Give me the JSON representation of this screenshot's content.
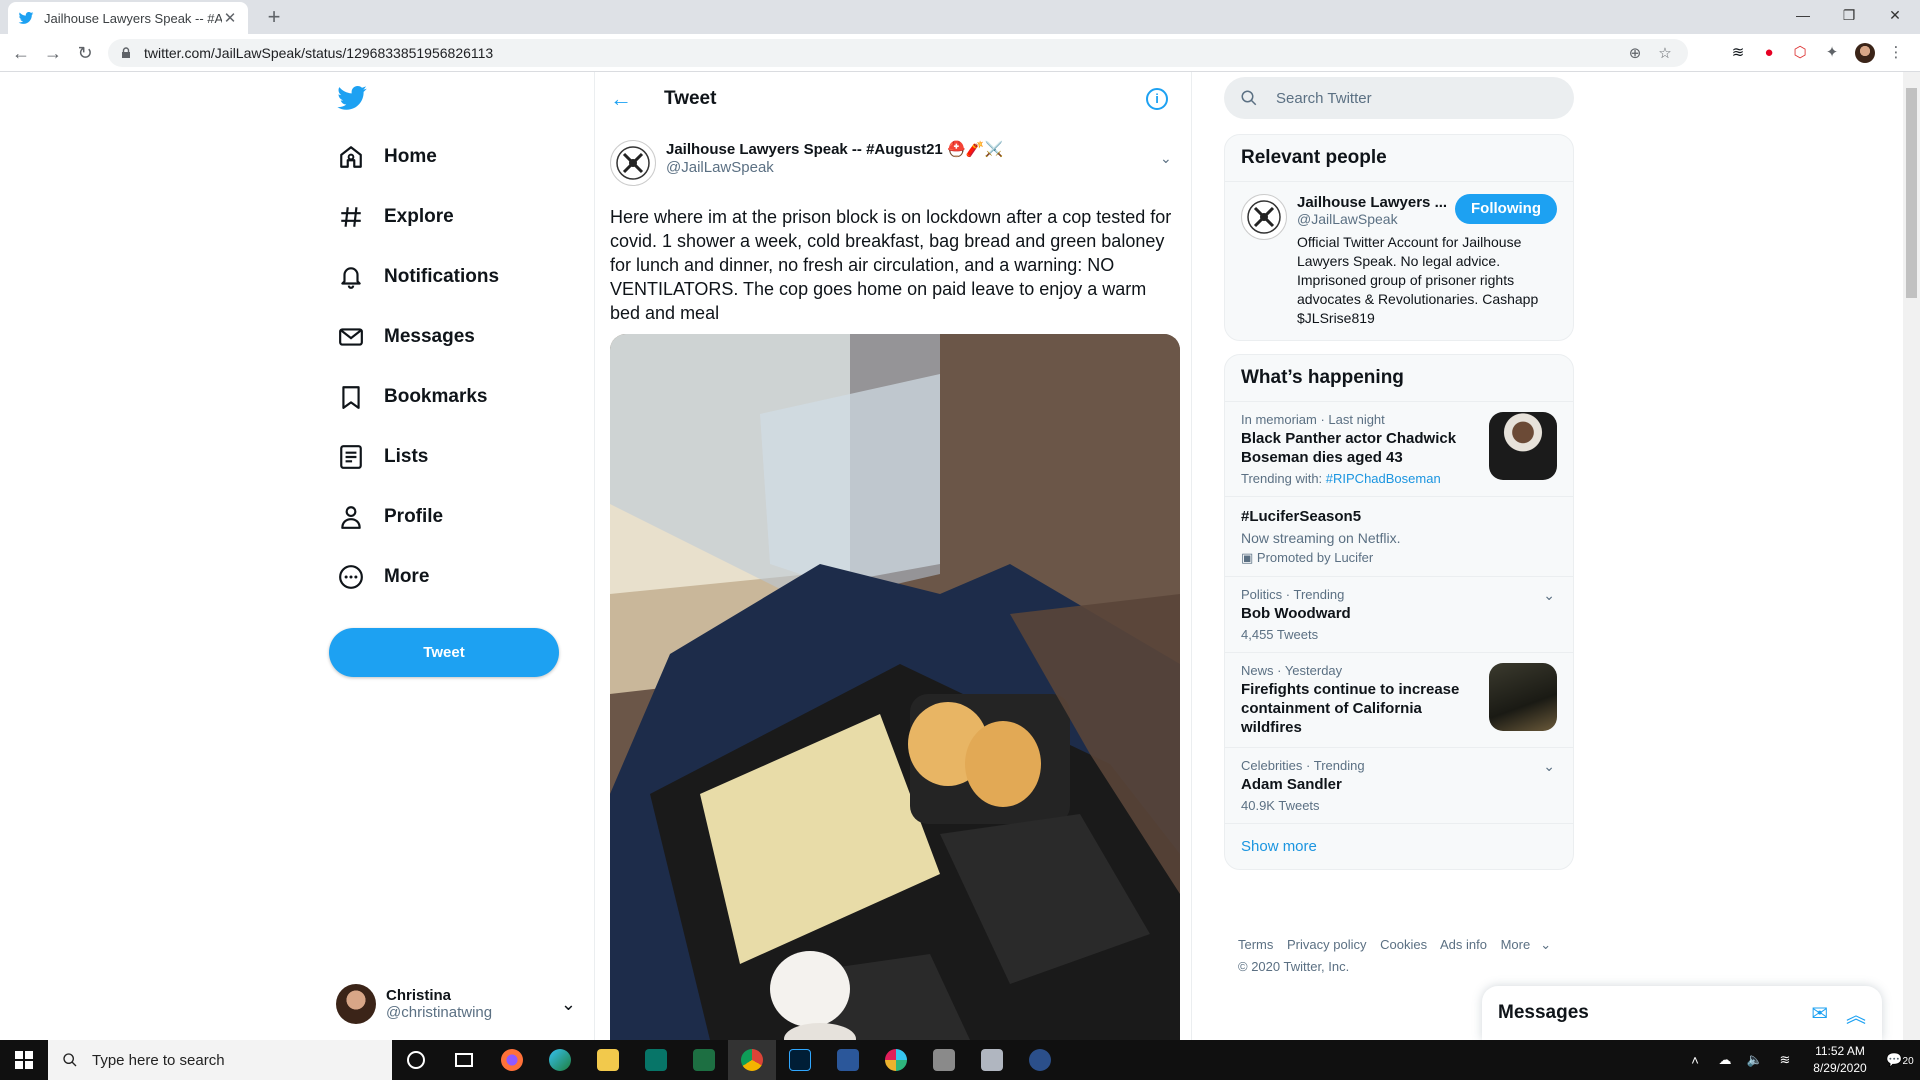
{
  "browser": {
    "tab_title": "Jailhouse Lawyers Speak -- #Aug",
    "url": "twitter.com/JailLawSpeak/status/1296833851956826113"
  },
  "nav": {
    "items": [
      {
        "label": "Home",
        "icon": "home-icon"
      },
      {
        "label": "Explore",
        "icon": "hashtag-icon"
      },
      {
        "label": "Notifications",
        "icon": "bell-icon"
      },
      {
        "label": "Messages",
        "icon": "mail-icon"
      },
      {
        "label": "Bookmarks",
        "icon": "bookmark-icon"
      },
      {
        "label": "Lists",
        "icon": "list-icon"
      },
      {
        "label": "Profile",
        "icon": "person-icon"
      },
      {
        "label": "More",
        "icon": "more-icon"
      }
    ],
    "tweet_button": "Tweet",
    "account": {
      "name": "Christina",
      "handle": "@christinatwing"
    }
  },
  "main": {
    "header_title": "Tweet",
    "tweet": {
      "display_name": "Jailhouse Lawyers Speak -- #August21",
      "emoji": "⛑️🧨⚔️",
      "handle": "@JailLawSpeak",
      "text": "Here where im at the prison block is on lockdown after a cop tested for covid. 1 shower a week, cold breakfast, bag bread and green baloney for lunch and dinner, no fresh air circulation, and a warning: NO VENTILATORS. The cop goes home on paid leave to enjoy a warm bed and meal"
    }
  },
  "right": {
    "search_placeholder": "Search Twitter",
    "relevant": {
      "title": "Relevant people",
      "name": "Jailhouse Lawyers ...",
      "handle": "@JailLawSpeak",
      "follow_label": "Following",
      "bio": "Official Twitter Account for Jailhouse Lawyers Speak. No legal advice. Imprisoned group of prisoner rights advocates & Revolutionaries. Cashapp $JLSrise819"
    },
    "happening": {
      "title": "What’s happening",
      "trends": [
        {
          "meta": "In memoriam · Last night",
          "head": "Black Panther actor Chadwick Boseman dies aged 43",
          "sub_prefix": "Trending with: ",
          "sub_tag": "#RIPChadBoseman"
        },
        {
          "meta": "",
          "head": "#LuciferSeason5",
          "sub": "Now streaming on Netflix.",
          "promo": "Promoted by Lucifer"
        },
        {
          "meta": "Politics · Trending",
          "head": "Bob Woodward",
          "sub": "4,455 Tweets"
        },
        {
          "meta": "News · Yesterday",
          "head": "Firefights continue to increase containment of California wildfires"
        },
        {
          "meta": "Celebrities · Trending",
          "head": "Adam Sandler",
          "sub": "40.9K Tweets"
        }
      ],
      "show_more": "Show more"
    },
    "footer": {
      "links": [
        "Terms",
        "Privacy policy",
        "Cookies",
        "Ads info",
        "More"
      ],
      "copyright": "© 2020 Twitter, Inc."
    },
    "messages_drawer": "Messages"
  },
  "taskbar": {
    "search_placeholder": "Type here to search",
    "time": "11:52 AM",
    "date": "8/29/2020",
    "notifications": "20"
  }
}
